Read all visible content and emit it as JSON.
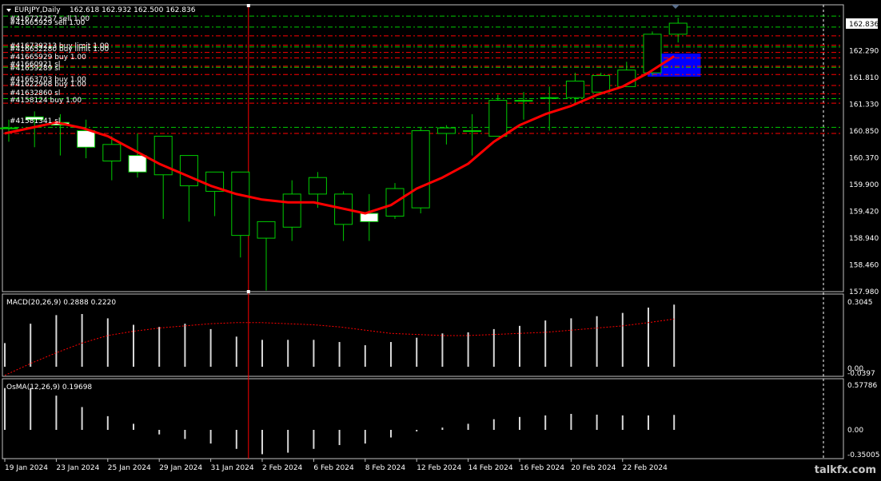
{
  "header": {
    "symbol_tf": "EURJPY,Daily",
    "ohlc": "162.618 162.932 162.500 162.836"
  },
  "watermark": "talkfx.com",
  "colors": {
    "background": "#000000",
    "frame": "#c0c0c0",
    "candle_up_fill": "#000000",
    "candle_down_fill": "#ffffff",
    "candle_outline": "#00cc00",
    "ma": "#ff0000",
    "order_lines": "#ff0000",
    "tp_lines": "#00cc00",
    "zone": "#0000ff",
    "histogram": "#d8d8d8",
    "signal": "#ff0000",
    "vline": "#ff0000",
    "text": "#ffffff"
  },
  "order_labels": [
    {
      "text": "#416727257 sell 1.00"
    },
    {
      "text": "#41665929 sell 1.00"
    },
    {
      "text": "#416739213 buy limit 1.00"
    },
    {
      "text": "#416652280 buy limit 1.00"
    },
    {
      "text": "#41665929 buy 1.00"
    },
    {
      "text": "#41660921 sl"
    },
    {
      "text": "#41659289 sl"
    },
    {
      "text": "#41663703 buy 1.00"
    },
    {
      "text": "#41622968 buy 1.00"
    },
    {
      "text": "#41632860 sl"
    },
    {
      "text": "#4158124 buy 1.00"
    },
    {
      "text": "#41581341 sl"
    }
  ],
  "chart_data": [
    {
      "type": "candlestick",
      "title": "EURJPY,Daily",
      "x_tick_labels": [
        "19 Jan 2024",
        "23 Jan 2024",
        "25 Jan 2024",
        "29 Jan 2024",
        "31 Jan 2024",
        "2 Feb 2024",
        "6 Feb 2024",
        "8 Feb 2024",
        "12 Feb 2024",
        "14 Feb 2024",
        "16 Feb 2024",
        "20 Feb 2024",
        "22 Feb 2024"
      ],
      "y_tick_labels": [
        "162.836",
        "162.290",
        "161.810",
        "161.330",
        "160.850",
        "160.370",
        "159.900",
        "159.420",
        "158.940",
        "158.460",
        "157.980"
      ],
      "ylim": [
        157.98,
        162.95
      ],
      "candles": [
        {
          "o": 160.95,
          "h": 161.1,
          "l": 160.7,
          "c": 160.95
        },
        {
          "o": 161.15,
          "h": 161.25,
          "l": 160.6,
          "c": 161.1
        },
        {
          "o": 161.05,
          "h": 161.2,
          "l": 160.45,
          "c": 161.0
        },
        {
          "o": 160.9,
          "h": 161.1,
          "l": 160.4,
          "c": 160.6
        },
        {
          "o": 160.35,
          "h": 160.8,
          "l": 160.0,
          "c": 160.65
        },
        {
          "o": 160.45,
          "h": 160.85,
          "l": 160.05,
          "c": 160.15
        },
        {
          "o": 160.1,
          "h": 160.45,
          "l": 159.3,
          "c": 160.8
        },
        {
          "o": 159.9,
          "h": 160.35,
          "l": 159.25,
          "c": 160.45
        },
        {
          "o": 159.8,
          "h": 160.1,
          "l": 159.35,
          "c": 160.15
        },
        {
          "o": 159.0,
          "h": 160.15,
          "l": 158.6,
          "c": 160.15
        },
        {
          "o": 158.95,
          "h": 159.2,
          "l": 158.0,
          "c": 159.25
        },
        {
          "o": 159.15,
          "h": 160.0,
          "l": 158.9,
          "c": 159.75
        },
        {
          "o": 159.75,
          "h": 160.15,
          "l": 159.5,
          "c": 160.05
        },
        {
          "o": 159.2,
          "h": 159.8,
          "l": 158.9,
          "c": 159.75
        },
        {
          "o": 159.4,
          "h": 159.75,
          "l": 158.9,
          "c": 159.25
        },
        {
          "o": 159.35,
          "h": 159.95,
          "l": 159.3,
          "c": 159.85
        },
        {
          "o": 159.5,
          "h": 160.95,
          "l": 159.4,
          "c": 160.9
        },
        {
          "o": 160.85,
          "h": 161.0,
          "l": 160.65,
          "c": 160.95
        },
        {
          "o": 160.9,
          "h": 161.2,
          "l": 160.45,
          "c": 160.9
        },
        {
          "o": 160.8,
          "h": 161.55,
          "l": 160.8,
          "c": 161.45
        },
        {
          "o": 161.45,
          "h": 161.6,
          "l": 161.1,
          "c": 161.45
        },
        {
          "o": 161.5,
          "h": 161.7,
          "l": 160.9,
          "c": 161.5
        },
        {
          "o": 161.5,
          "h": 161.95,
          "l": 161.4,
          "c": 161.8
        },
        {
          "o": 161.6,
          "h": 161.95,
          "l": 161.55,
          "c": 161.9
        },
        {
          "o": 161.7,
          "h": 162.15,
          "l": 161.7,
          "c": 162.0
        },
        {
          "o": 161.95,
          "h": 162.7,
          "l": 161.9,
          "c": 162.65
        },
        {
          "o": 162.65,
          "h": 162.95,
          "l": 162.5,
          "c": 162.85
        }
      ],
      "ma_series": {
        "values": [
          160.85,
          160.95,
          161.05,
          160.95,
          160.8,
          160.55,
          160.3,
          160.1,
          159.9,
          159.75,
          159.65,
          159.6,
          159.6,
          159.5,
          159.4,
          159.55,
          159.85,
          160.05,
          160.3,
          160.7,
          161.0,
          161.2,
          161.35,
          161.55,
          161.7,
          161.95,
          162.25
        ]
      },
      "order_lines_red": [
        162.62,
        162.45,
        162.32,
        162.22,
        162.07,
        161.92,
        161.72,
        161.57,
        161.4,
        160.85
      ],
      "order_lines_green": [
        162.98,
        162.78,
        162.42,
        162.05,
        161.48,
        160.96
      ],
      "zone": {
        "from_index": 25,
        "to_index": 27,
        "low": 161.88,
        "high": 162.3
      },
      "vertical_marker_index": 9
    },
    {
      "type": "bar",
      "title": "MACD(20,26,9) 0.2888 0.2220",
      "name": "MACD(20,26,9)",
      "y_tick_labels": [
        "0.3045",
        "0.00",
        "-0.0397"
      ],
      "ylim": [
        -0.0397,
        0.3045
      ],
      "values": [
        0.11,
        0.2,
        0.24,
        0.245,
        0.225,
        0.195,
        0.185,
        0.2,
        0.175,
        0.14,
        0.125,
        0.125,
        0.125,
        0.115,
        0.1,
        0.115,
        0.135,
        0.155,
        0.16,
        0.175,
        0.19,
        0.215,
        0.225,
        0.235,
        0.25,
        0.275,
        0.2888
      ],
      "signal": [
        -0.04,
        0.015,
        0.065,
        0.11,
        0.145,
        0.165,
        0.18,
        0.19,
        0.2,
        0.205,
        0.205,
        0.2,
        0.195,
        0.185,
        0.17,
        0.155,
        0.15,
        0.145,
        0.145,
        0.15,
        0.155,
        0.16,
        0.17,
        0.18,
        0.19,
        0.205,
        0.222
      ]
    },
    {
      "type": "bar",
      "title": "OsMA(12,26,9) 0.19698",
      "name": "OsMA(12,26,9)",
      "y_tick_labels": [
        "0.57786",
        "0.00",
        "-0.35005"
      ],
      "ylim": [
        -0.35005,
        0.57786
      ],
      "values": [
        0.55,
        0.55,
        0.45,
        0.3,
        0.18,
        0.08,
        -0.06,
        -0.12,
        -0.18,
        -0.25,
        -0.32,
        -0.3,
        -0.25,
        -0.2,
        -0.18,
        -0.1,
        -0.02,
        0.03,
        0.08,
        0.14,
        0.17,
        0.19,
        0.21,
        0.2,
        0.19,
        0.19,
        0.19698
      ]
    }
  ]
}
